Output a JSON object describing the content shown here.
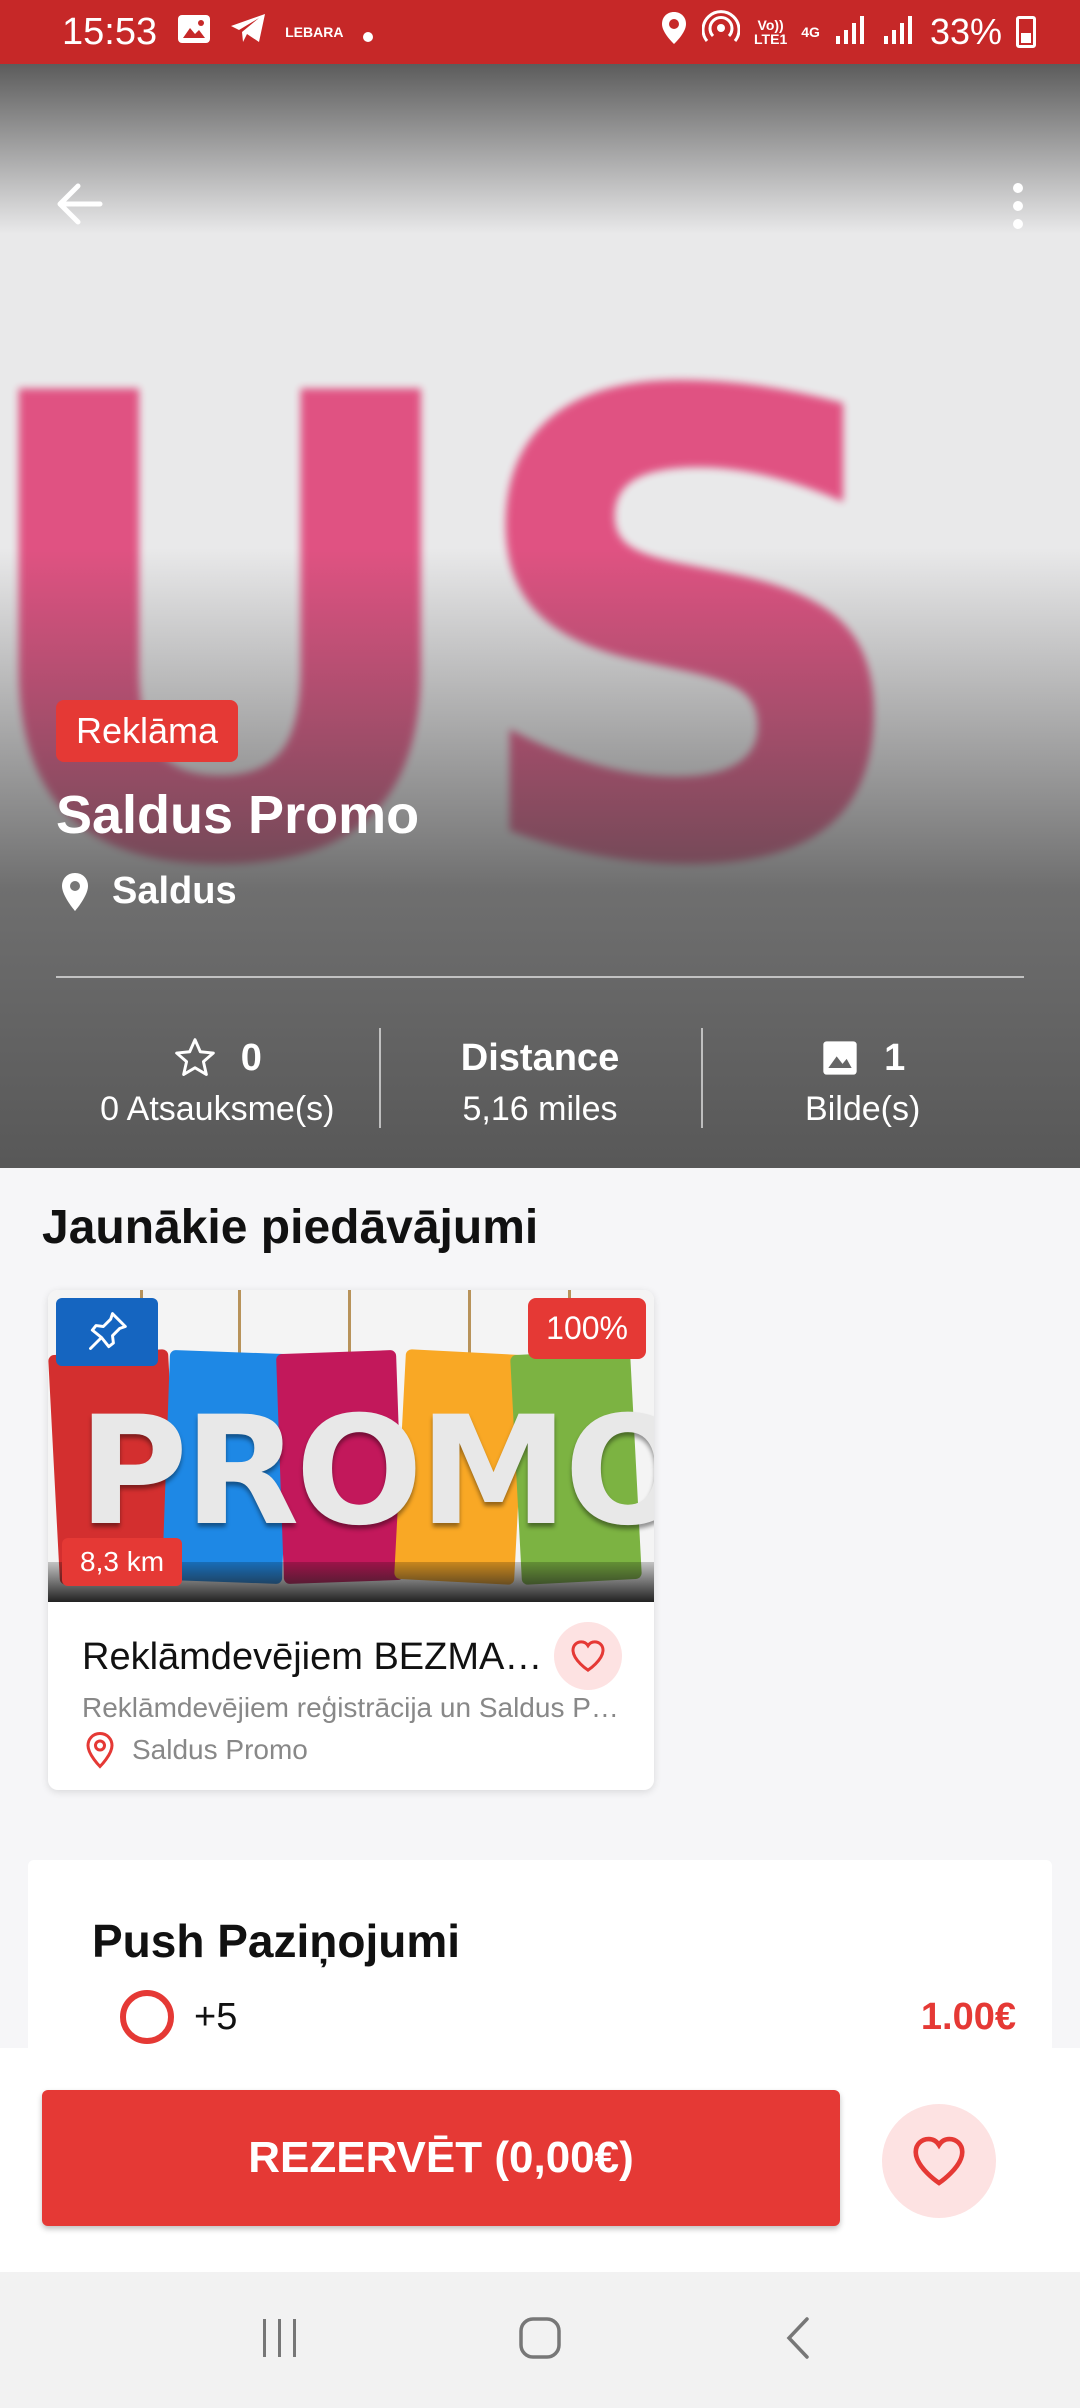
{
  "status_bar": {
    "time": "15:53",
    "carrier_label": "LEBARA",
    "volte_line1": "Vo))",
    "volte_line2": "LTE1",
    "network": "4G",
    "battery": "33%"
  },
  "hero": {
    "badge": "Reklāma",
    "title": "Saldus Promo",
    "location": "Saldus",
    "stats": {
      "rating_value": "0",
      "reviews_label": "0 Atsauksme(s)",
      "distance_title": "Distance",
      "distance_value": "5,16 miles",
      "images_count": "1",
      "images_label": "Bilde(s)"
    }
  },
  "offers": {
    "section_title": "Jaunākie piedāvājumi",
    "card": {
      "image_text": "PROMO",
      "discount": "100%",
      "distance": "8,3 km",
      "title": "Reklāmdevējiem BEZMAKSAS",
      "description": "Reklāmdevējiem reģistrācija un Saldus Promo",
      "location": "Saldus Promo"
    }
  },
  "push": {
    "title": "Push Paziņojumi",
    "option_label": "+5",
    "option_price": "1.00€"
  },
  "footer": {
    "reserve_label": "REZERVĒT (0,00€)"
  },
  "colors": {
    "accent": "#e53935",
    "status_bar": "#c62828",
    "pin_blue": "#1565c0"
  }
}
